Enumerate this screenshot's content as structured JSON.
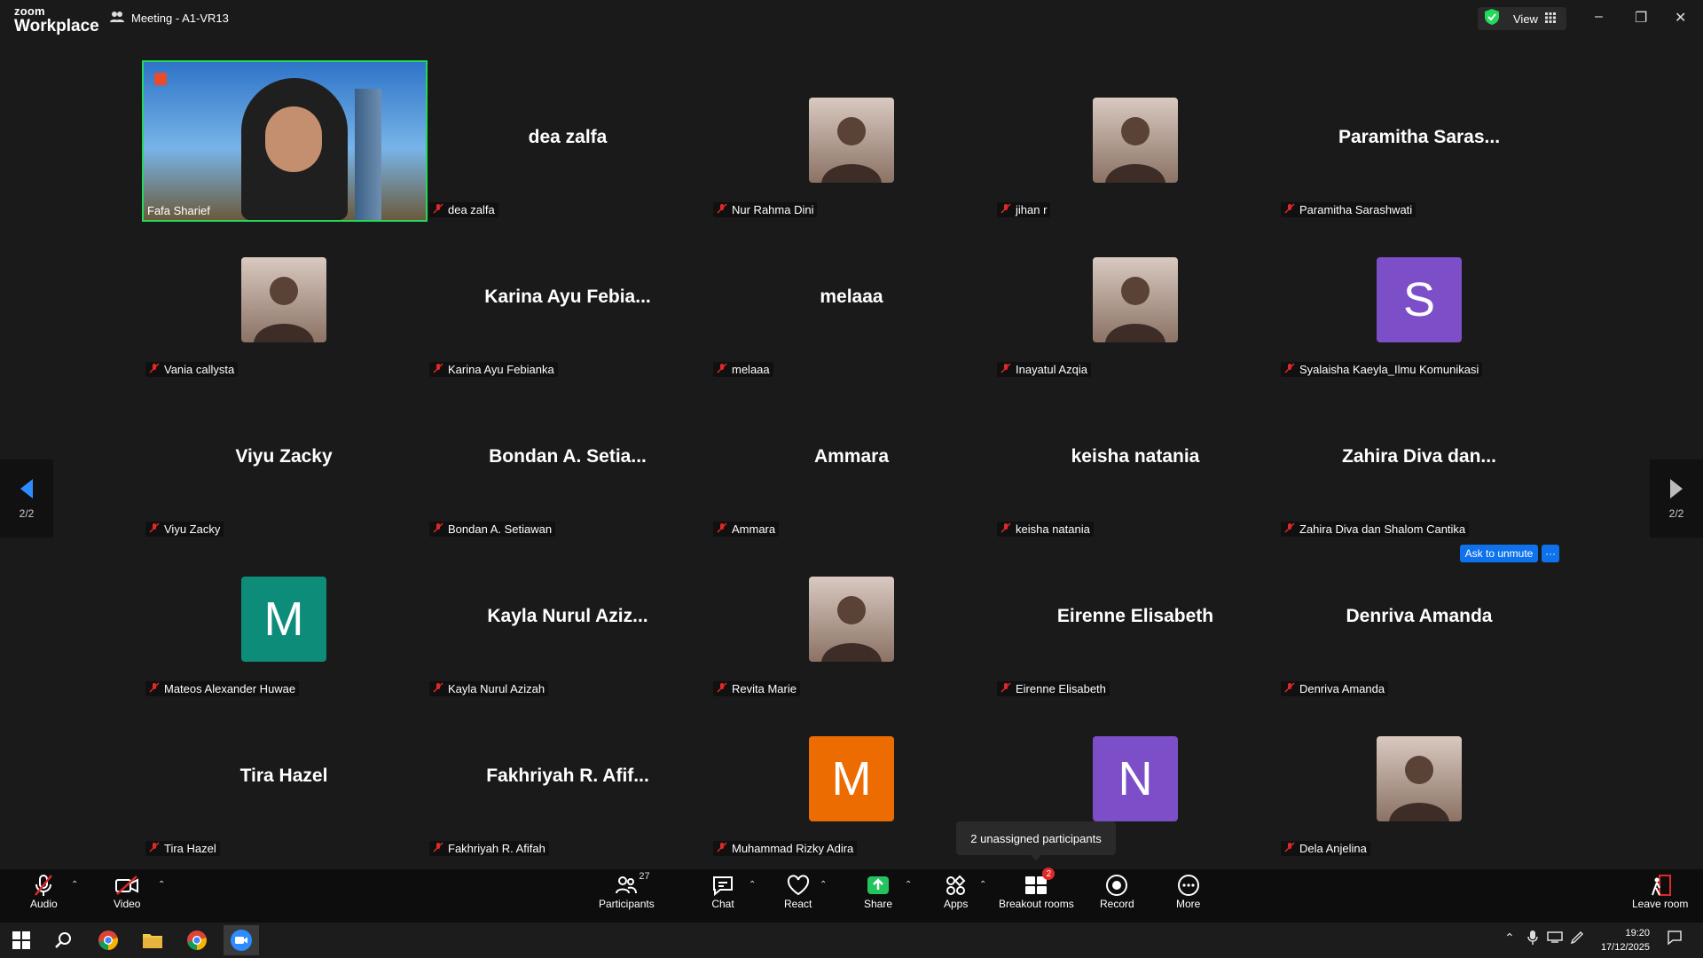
{
  "titlebar": {
    "logo_top": "zoom",
    "logo_bottom": "Workplace",
    "meeting_title": "Meeting - A1-VR13",
    "view_label": "View"
  },
  "gallery": {
    "page_indicator_left": "2/2",
    "page_indicator_right": "2/2",
    "active_video_name": "Fafa Sharief",
    "tiles": [
      {
        "big": "dea zalfa",
        "name": "dea zalfa"
      },
      {
        "big": "",
        "name": "Nur Rahma Dini",
        "avatar": "photo"
      },
      {
        "big": "",
        "name": "jihan r",
        "avatar": "photo"
      },
      {
        "big": "Paramitha Saras...",
        "name": "Paramitha Sarashwati"
      },
      {
        "big": "",
        "name": "Vania callysta",
        "avatar": "photo"
      },
      {
        "big": "Karina Ayu Febia...",
        "name": "Karina Ayu Febianka"
      },
      {
        "big": "melaaa",
        "name": "melaaa"
      },
      {
        "big": "",
        "name": "Inayatul Azqia",
        "avatar": "photo"
      },
      {
        "big": "",
        "name": "Syalaisha Kaeyla_Ilmu Komunikasi",
        "letter": "S",
        "color": "#7c4fc9"
      },
      {
        "big": "Viyu Zacky",
        "name": "Viyu Zacky"
      },
      {
        "big": "Bondan A. Setia...",
        "name": "Bondan A. Setiawan"
      },
      {
        "big": "Ammara",
        "name": "Ammara"
      },
      {
        "big": "keisha natania",
        "name": "keisha natania"
      },
      {
        "big": "Zahira Diva dan...",
        "name": "Zahira Diva dan Shalom Cantika"
      },
      {
        "big": "",
        "name": "Mateos Alexander Huwae",
        "letter": "M",
        "color": "#0e8c7a"
      },
      {
        "big": "Kayla Nurul Aziz...",
        "name": "Kayla Nurul Azizah"
      },
      {
        "big": "",
        "name": "Revita Marie",
        "avatar": "photo"
      },
      {
        "big": "Eirenne Elisabeth",
        "name": "Eirenne Elisabeth"
      },
      {
        "big": "Denriva Amanda",
        "name": "Denriva Amanda"
      },
      {
        "big": "Tira Hazel",
        "name": "Tira Hazel"
      },
      {
        "big": "Fakhriyah R. Afif...",
        "name": "Fakhriyah R. Afifah"
      },
      {
        "big": "",
        "name": "Muhammad Rizky Adira",
        "letter": "M",
        "color": "#ed6c02"
      },
      {
        "big": "",
        "name": "",
        "letter": "N",
        "color": "#7c4fc9"
      },
      {
        "big": "",
        "name": "Dela Anjelina",
        "avatar": "photo"
      }
    ],
    "ask_unmute": "Ask to unmute",
    "more_dots": "···",
    "tooltip": "2 unassigned participants"
  },
  "toolbar": {
    "audio": "Audio",
    "video": "Video",
    "participants": "Participants",
    "participants_count": "27",
    "chat": "Chat",
    "react": "React",
    "share": "Share",
    "apps": "Apps",
    "breakout": "Breakout rooms",
    "breakout_badge": "2",
    "record": "Record",
    "more": "More",
    "leave": "Leave room"
  },
  "taskbar": {
    "time": "19:20",
    "date": "17/12/2025"
  },
  "colors": {
    "accent": "#0e72ed",
    "active_speaker": "#23d959",
    "muted": "#e02828"
  }
}
